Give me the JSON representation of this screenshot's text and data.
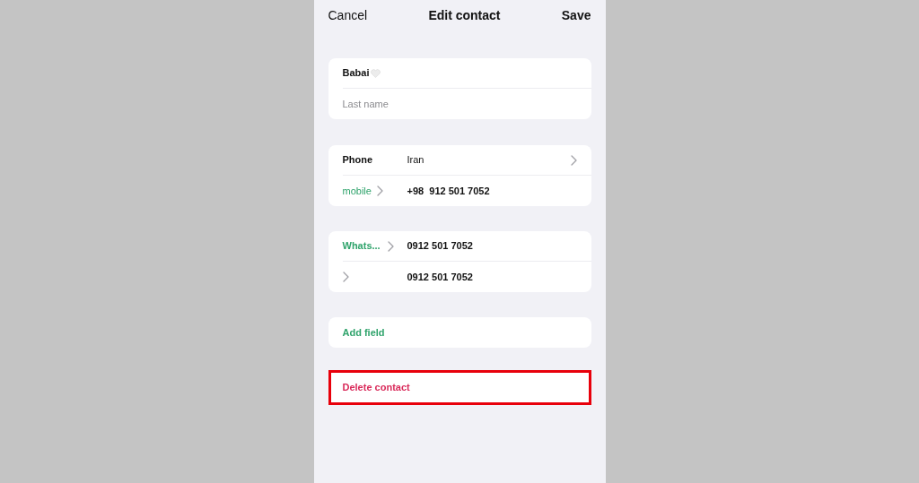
{
  "header": {
    "cancel": "Cancel",
    "title": "Edit contact",
    "save": "Save"
  },
  "name_fields": [
    {
      "value": "Babai",
      "heart": true
    },
    {
      "placeholder": "Last name"
    }
  ],
  "phone": {
    "label": "Phone",
    "country": "Iran",
    "type": "mobile",
    "number": "+98  912 501 7052"
  },
  "extra_numbers": [
    {
      "label": "Whats...",
      "number": "0912 501 7052"
    },
    {
      "number": "0912 501 7052"
    }
  ],
  "add_field": "Add field",
  "delete": {
    "label": "Delete contact",
    "highlighted": true
  }
}
